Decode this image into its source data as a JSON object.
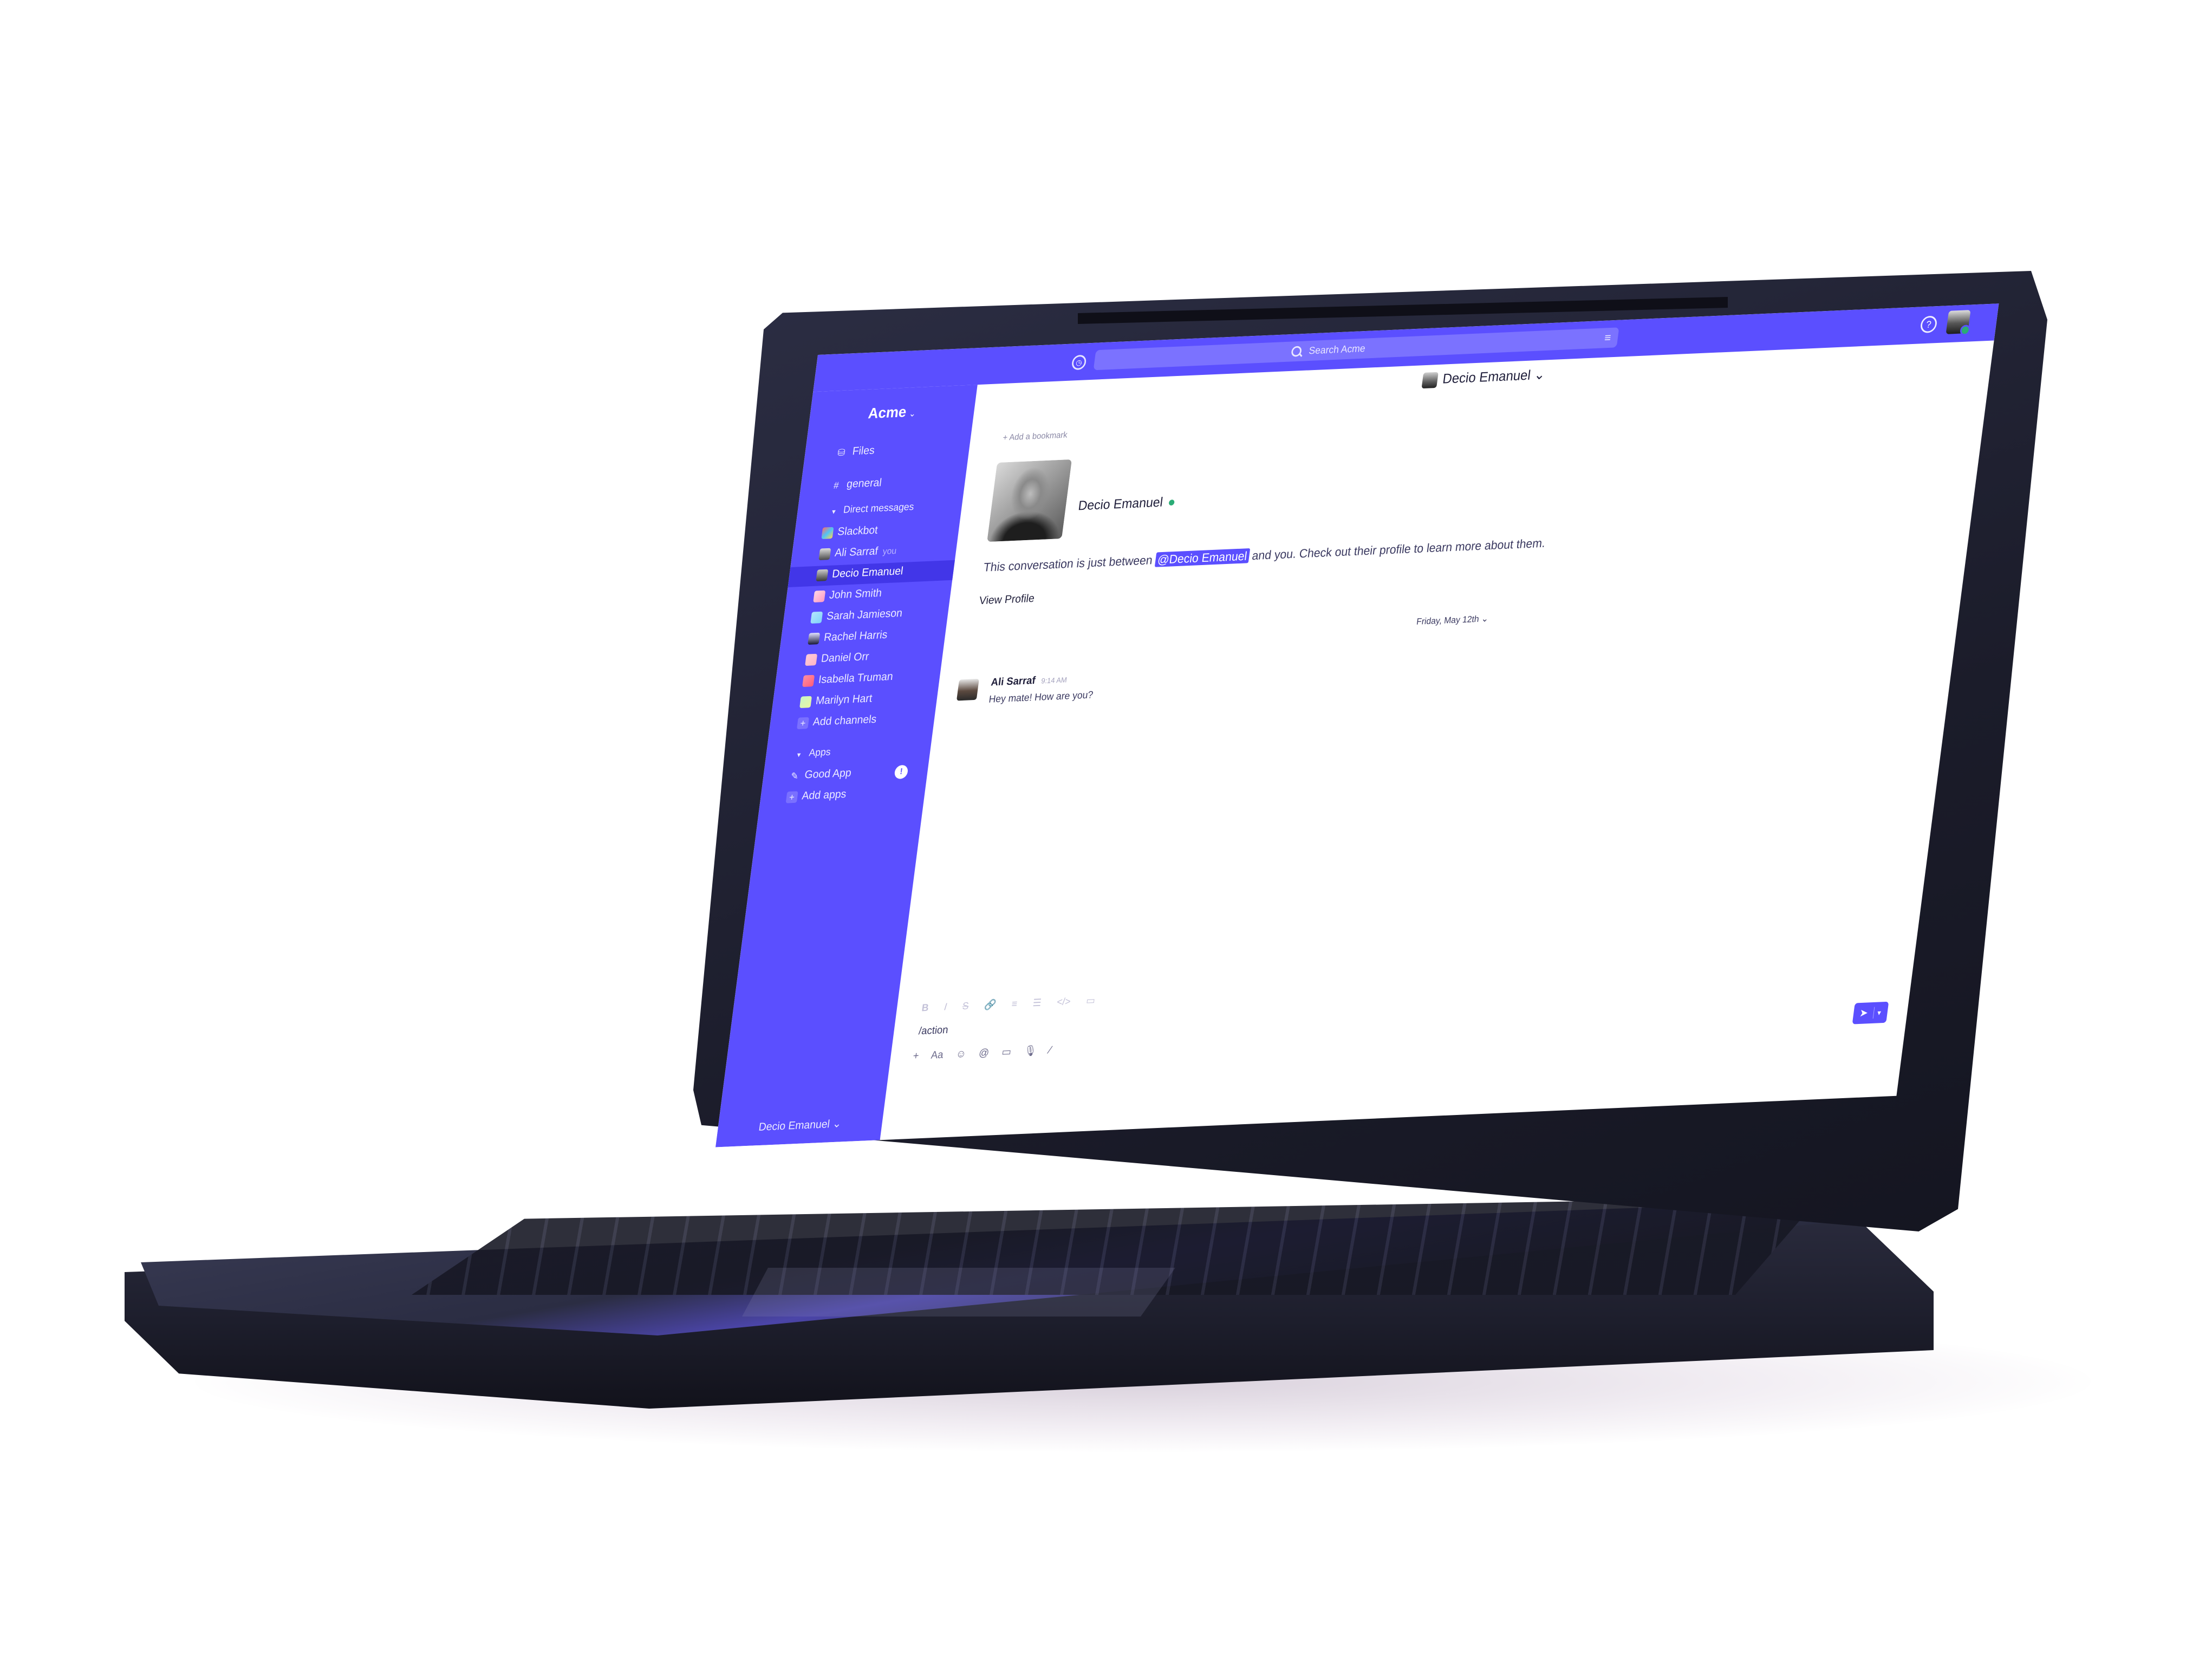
{
  "topbar": {
    "search_placeholder": "Search Acme",
    "history_icon": "clock-icon",
    "filter_icon": "filter-icon",
    "help_icon": "help-icon"
  },
  "sidebar": {
    "workspace": "Acme",
    "workspace_chevron": "⌄",
    "files_label": "Files",
    "channel_label": "general",
    "dm_section": "Direct messages",
    "dms": [
      {
        "name": "Slackbot"
      },
      {
        "name": "Ali Sarraf",
        "sub": "you"
      },
      {
        "name": "Decio Emanuel",
        "active": true
      },
      {
        "name": "John Smith"
      },
      {
        "name": "Sarah Jamieson"
      },
      {
        "name": "Rachel Harris"
      },
      {
        "name": "Daniel Orr"
      },
      {
        "name": "Isabella Truman"
      },
      {
        "name": "Marilyn Hart"
      }
    ],
    "add_channels": "Add channels",
    "apps_section": "Apps",
    "app_name": "Good App",
    "app_badge": "!",
    "add_apps": "Add apps",
    "footer_user": "Decio Emanuel",
    "footer_chevron": "⌄"
  },
  "main": {
    "header_name": "Decio Emanuel",
    "header_chevron": "⌄",
    "bookmark": "+ Add a bookmark",
    "profile_name": "Decio Emanuel",
    "intro_before": "This conversation is just between ",
    "intro_mention": "@Decio Emanuel",
    "intro_after": " and you. Check out their profile to learn more about them.",
    "view_profile": "View Profile",
    "date_divider": "Friday, May 12th",
    "date_chevron": "⌄",
    "message": {
      "author": "Ali Sarraf",
      "time": "9:14 AM",
      "text": "Hey mate! How are you?"
    }
  },
  "composer": {
    "input_value": "/action",
    "format_buttons": [
      "B",
      "I",
      "S",
      "🔗",
      "≡",
      "☰",
      "</>",
      "▭"
    ],
    "tool_buttons": [
      "+",
      "Aa",
      "☺",
      "@",
      "▭",
      "🎙",
      "⁄"
    ]
  },
  "colors": {
    "accent": "#5b4fff",
    "sidebar_active": "#4236e8",
    "presence": "#2bac76"
  }
}
